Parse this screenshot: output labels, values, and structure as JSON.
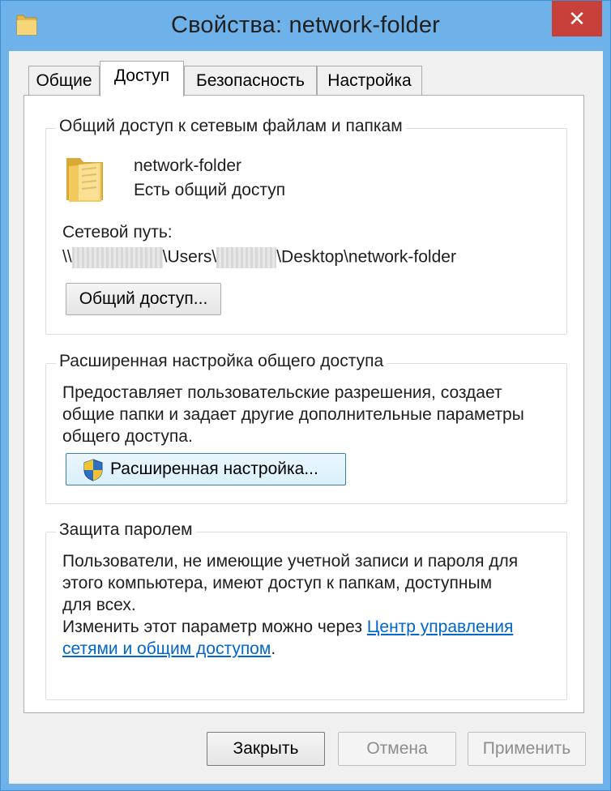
{
  "window": {
    "title": "Свойства: network-folder",
    "close_label": "✕"
  },
  "tabs": [
    {
      "label": "Общие",
      "active": false
    },
    {
      "label": "Доступ",
      "active": true
    },
    {
      "label": "Безопасность",
      "active": false
    },
    {
      "label": "Настройка",
      "active": false
    }
  ],
  "sharing": {
    "legend": "Общий доступ к сетевым файлам и папкам",
    "folder_name": "network-folder",
    "status": "Есть общий доступ",
    "path_label": "Сетевой путь:",
    "path_prefix": "\\\\",
    "path_users": "\\Users\\",
    "path_suffix": "\\Desktop\\network-folder",
    "share_button": "Общий доступ..."
  },
  "advanced": {
    "legend": "Расширенная настройка общего доступа",
    "description_lines": [
      "Предоставляет пользовательские разрешения, создает",
      "общие папки и задает другие дополнительные параметры",
      "общего доступа."
    ],
    "button": "Расширенная настройка..."
  },
  "password": {
    "legend": "Защита паролем",
    "description_lines": [
      "Пользователи, не имеющие учетной записи и пароля для",
      "этого компьютера, имеют доступ к папкам, доступным",
      "для всех."
    ],
    "change_text": "Изменить этот параметр можно через ",
    "link_line1": "Центр управления",
    "link_line2": "сетями и общим доступом",
    "link_end": "."
  },
  "footer": {
    "close": "Закрыть",
    "cancel": "Отмена",
    "apply": "Применить"
  },
  "colors": {
    "frame": "#6fb2e9",
    "close_button": "#c7403a",
    "link": "#0066cc"
  }
}
